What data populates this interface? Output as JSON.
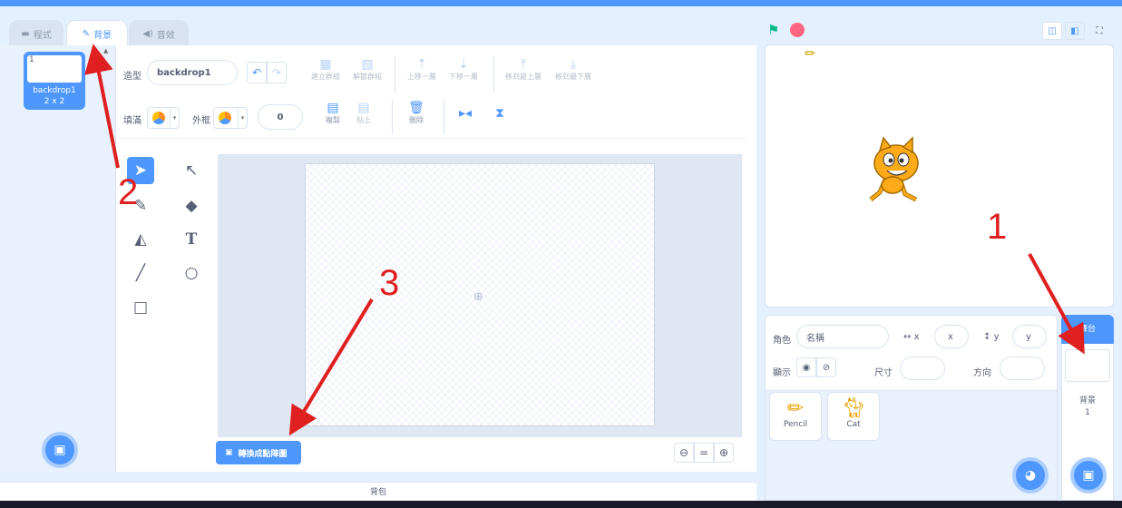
{
  "tabs": [
    {
      "label": "程式",
      "icon": "code-icon"
    },
    {
      "label": "背景",
      "icon": "brush-icon"
    },
    {
      "label": "音效",
      "icon": "speaker-icon"
    }
  ],
  "costume": {
    "index": "1",
    "name": "backdrop1",
    "size": "2 x 2"
  },
  "editor": {
    "shape_label": "造型",
    "shape_name": "backdrop1",
    "fill_label": "填滿",
    "outline_label": "外框",
    "outline_width": "0",
    "group": "建立群組",
    "ungroup": "解散群組",
    "forward": "上移一層",
    "backward": "下移一層",
    "front": "移到最上層",
    "back": "移到最下層",
    "copy": "複製",
    "paste": "貼上",
    "delete": "刪除",
    "convert": "轉換成點陣圖",
    "zoom_out": "⊖",
    "zoom_reset": "=",
    "zoom_in": "⊕"
  },
  "backpack": "背包",
  "sprite_info": {
    "sprite_label": "角色",
    "name_placeholder": "名稱",
    "x_label": "x",
    "x_placeholder": "x",
    "y_label": "y",
    "y_placeholder": "y",
    "show_label": "顯示",
    "size_label": "尺寸",
    "direction_label": "方向"
  },
  "sprites": [
    {
      "name": "Pencil",
      "icon": "pencil-icon"
    },
    {
      "name": "Cat",
      "icon": "cat-icon"
    }
  ],
  "stage_panel": {
    "title": "舞台",
    "backdrops_label": "背景",
    "backdrops_count": "1"
  },
  "annotations": [
    "1",
    "2",
    "3"
  ],
  "colors": {
    "accent": "#4d97ff",
    "arrow": "#e02020",
    "flag": "#0fbd8c",
    "stop": "#ff6680"
  }
}
